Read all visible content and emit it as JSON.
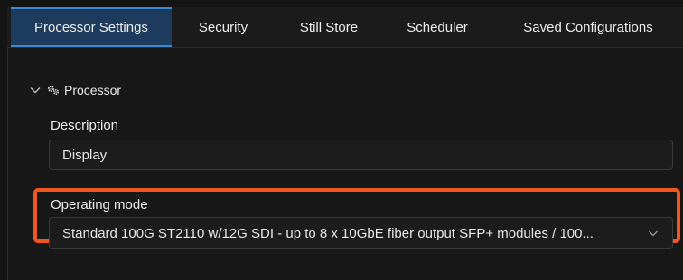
{
  "tabs": [
    {
      "label": "Processor Settings",
      "active": true
    },
    {
      "label": "Security"
    },
    {
      "label": "Still Store"
    },
    {
      "label": "Scheduler"
    },
    {
      "label": "Saved Configurations"
    }
  ],
  "section": {
    "title": "Processor",
    "expanded": true,
    "icons": {
      "toggle": "chevron-down-icon",
      "section": "gears-icon"
    }
  },
  "description": {
    "label": "Description",
    "value": "Display"
  },
  "operating_mode": {
    "label": "Operating mode",
    "value": "Standard 100G ST2110 w/12G SDI - up to 8 x 10GbE fiber output SFP+ modules / 100..."
  },
  "colors": {
    "active_tab_bg": "#1d3b5c",
    "active_tab_accent": "#3a8ad6",
    "highlight": "#f0561d"
  }
}
